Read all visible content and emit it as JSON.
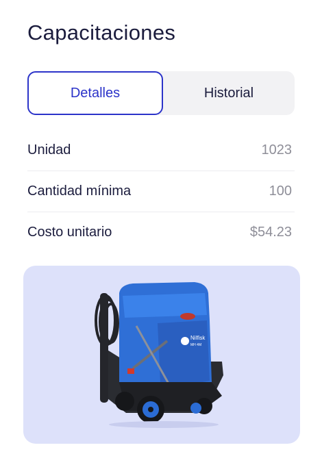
{
  "page": {
    "title": "Capacitaciones"
  },
  "tabs": [
    {
      "label": "Detalles",
      "active": true
    },
    {
      "label": "Historial",
      "active": false
    }
  ],
  "details": [
    {
      "label": "Unidad",
      "value": "1023"
    },
    {
      "label": "Cantidad mínima",
      "value": "100"
    },
    {
      "label": "Costo unitario",
      "value": "$54.23"
    }
  ],
  "product_image": {
    "brand_text": "Nilfisk",
    "model_text": "MH 4M"
  },
  "colors": {
    "accent": "#2b33c9",
    "card_bg": "#dde1fa",
    "machine_blue": "#2f6fd6",
    "machine_dark": "#2a2c31"
  }
}
